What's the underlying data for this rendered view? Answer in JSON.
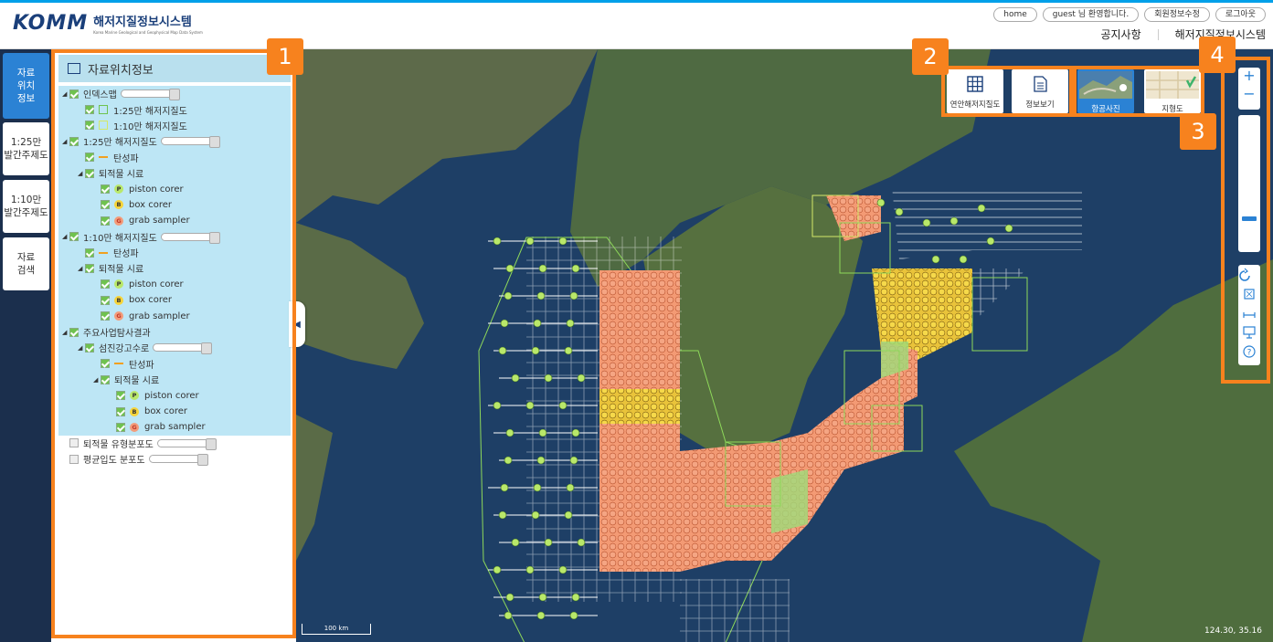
{
  "header": {
    "logo_mark": "KOMM",
    "logo_title": "해저지질정보시스템",
    "logo_subtitle": "Korea Marine Geological and Geophysical Map Data System",
    "util_buttons": [
      "home",
      "guest 님 환영합니다.",
      "회원정보수정",
      "로그아웃"
    ],
    "gnb": [
      "공지사항",
      "해저지질정보시스템"
    ]
  },
  "leftnav": [
    {
      "label": "자료\n위치\n정보",
      "active": true
    },
    {
      "label": "1:25만\n발간주제도",
      "active": false
    },
    {
      "label": "1:10만\n발간주제도",
      "active": false
    },
    {
      "label": "자료\n검색",
      "active": false
    }
  ],
  "panel": {
    "title": "자료위치정보",
    "tree": [
      {
        "level": 0,
        "label": "인덱스맵",
        "checked": true,
        "expand": true,
        "slider": true,
        "hl": true
      },
      {
        "level": 1,
        "label": "1:25만 해저지질도",
        "checked": true,
        "sym": "sq",
        "hl": true
      },
      {
        "level": 1,
        "label": "1:10만 해저지질도",
        "checked": true,
        "sym": "sq2",
        "hl": true
      },
      {
        "level": 0,
        "label": "1:25만 해저지질도",
        "checked": true,
        "expand": true,
        "slider": true,
        "hl": true
      },
      {
        "level": 1,
        "label": "탄성파",
        "checked": true,
        "sym": "line",
        "hl": true
      },
      {
        "level": 1,
        "label": "퇴적물 시료",
        "checked": true,
        "expand": true,
        "hl": true
      },
      {
        "level": 2,
        "label": "piston corer",
        "checked": true,
        "sym": "p",
        "hl": true
      },
      {
        "level": 2,
        "label": "box corer",
        "checked": true,
        "sym": "b",
        "hl": true
      },
      {
        "level": 2,
        "label": "grab sampler",
        "checked": true,
        "sym": "g",
        "hl": true
      },
      {
        "level": 0,
        "label": "1:10만 해저지질도",
        "checked": true,
        "expand": true,
        "slider": true,
        "hl": true
      },
      {
        "level": 1,
        "label": "탄성파",
        "checked": true,
        "sym": "line",
        "hl": true
      },
      {
        "level": 1,
        "label": "퇴적물 시료",
        "checked": true,
        "expand": true,
        "hl": true
      },
      {
        "level": 2,
        "label": "piston corer",
        "checked": true,
        "sym": "p",
        "hl": true
      },
      {
        "level": 2,
        "label": "box corer",
        "checked": true,
        "sym": "b",
        "hl": true
      },
      {
        "level": 2,
        "label": "grab sampler",
        "checked": true,
        "sym": "g",
        "hl": true
      },
      {
        "level": 0,
        "label": "주요사업탐사결과",
        "checked": true,
        "expand": true,
        "hl": true
      },
      {
        "level": 1,
        "label": "섬진강고수로",
        "checked": true,
        "expand": true,
        "slider": true,
        "hl": true
      },
      {
        "level": 2,
        "label": "탄성파",
        "checked": true,
        "sym": "line",
        "hl": true
      },
      {
        "level": 2,
        "label": "퇴적물 시료",
        "checked": true,
        "expand": true,
        "hl": true
      },
      {
        "level": 3,
        "label": "piston corer",
        "checked": true,
        "sym": "p",
        "hl": true
      },
      {
        "level": 3,
        "label": "box corer",
        "checked": true,
        "sym": "b",
        "hl": true
      },
      {
        "level": 3,
        "label": "grab sampler",
        "checked": true,
        "sym": "g",
        "hl": true
      },
      {
        "level": 0,
        "label": "퇴적물 유형분포도",
        "checked": false,
        "slider": true,
        "hl": false
      },
      {
        "level": 0,
        "label": "평균입도 분포도",
        "checked": false,
        "slider": true,
        "hl": false
      }
    ]
  },
  "map_tools": [
    {
      "label": "연안해저지질도",
      "icon": "grid-icon"
    },
    {
      "label": "정보보기",
      "icon": "document-icon"
    },
    {
      "label": "항공사진",
      "icon": "aerial-thumbnail",
      "selected": true
    },
    {
      "label": "지형도",
      "icon": "terrain-thumbnail",
      "selected": false
    }
  ],
  "zoom": {
    "in": "+",
    "out": "−",
    "level_fraction": 0.82
  },
  "scale_label": "100 km",
  "coords": "124.30, 35.16",
  "callouts": [
    "1",
    "2",
    "3",
    "4"
  ],
  "colors": {
    "accent": "#f7821e",
    "nav": "#1b2f4d",
    "active": "#2b82d4",
    "sea": "#1e3f66"
  }
}
